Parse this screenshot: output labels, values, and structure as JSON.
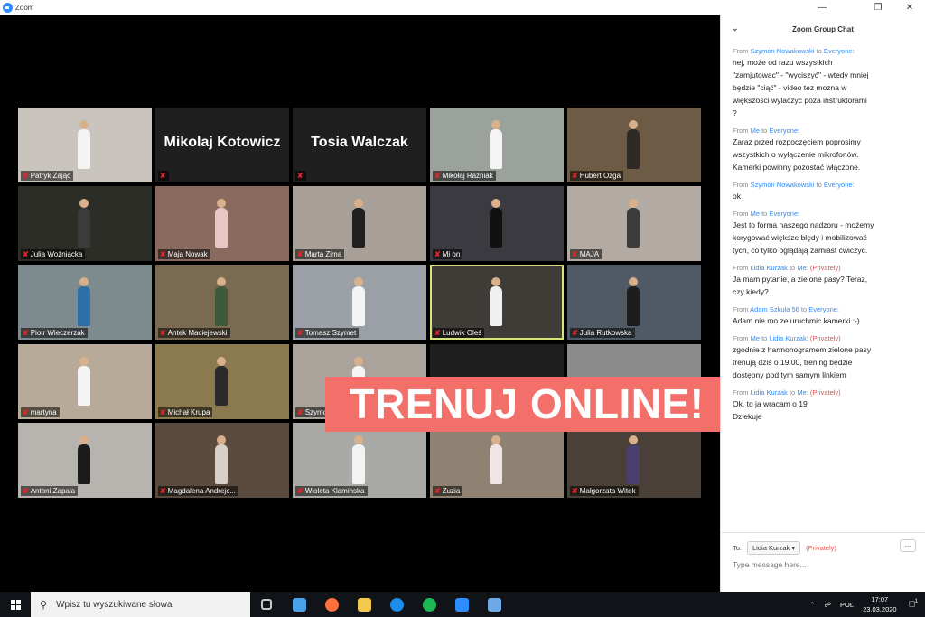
{
  "window": {
    "title": "Zoom"
  },
  "banner": {
    "text": "TRENUJ ONLINE!"
  },
  "tiles": [
    {
      "name": "Patryk Zając",
      "bg": "#c9c4bd",
      "fig": "#f3f3f3"
    },
    {
      "name": "Mikolaj Kotowicz",
      "bg": "#1f1f1f",
      "avatar": true
    },
    {
      "name": "Tosia Walczak",
      "bg": "#1f1f1f",
      "avatar": true
    },
    {
      "name": "Mikołaj Raźniak",
      "bg": "#9aa29b",
      "fig": "#f5f5f5"
    },
    {
      "name": "Hubert Ozga",
      "bg": "#6e5b46",
      "fig": "#2f2a25"
    },
    {
      "name": "Julia Woźniacka",
      "bg": "#2b2d26",
      "fig": "#3b3b3b"
    },
    {
      "name": "Maja Nowak",
      "bg": "#8a6a5e",
      "fig": "#e8c6c6"
    },
    {
      "name": "Marta Zima",
      "bg": "#a79f98",
      "fig": "#202020"
    },
    {
      "name": "Mi on",
      "bg": "#3a3a40",
      "fig": "#111111"
    },
    {
      "name": "MAJA",
      "bg": "#b3aba3",
      "fig": "#3c3c3c"
    },
    {
      "name": "Piotr Wieczerzak",
      "bg": "#7d8a8e",
      "fig": "#2f6fa8"
    },
    {
      "name": "Antek Maciejewski",
      "bg": "#7b6a52",
      "fig": "#3d5a3a"
    },
    {
      "name": "Tomasz Szymet",
      "bg": "#9aa0a6",
      "fig": "#f4f4f4"
    },
    {
      "name": "Ludwik Oleś",
      "bg": "#3f3b36",
      "fig": "#f0f0f0",
      "active": true
    },
    {
      "name": "Julia Rutkowska",
      "bg": "#4f5a64",
      "fig": "#1d1d1d"
    },
    {
      "name": "martyna",
      "bg": "#b8aa98",
      "fig": "#f4f4f4"
    },
    {
      "name": "Michał Krupa",
      "bg": "#8a7a4e",
      "fig": "#2a2a2a"
    },
    {
      "name": "Szymon",
      "bg": "#a9a39c",
      "fig": "#f5f5f5"
    },
    {
      "name": "",
      "bg": "#1f1f1f"
    },
    {
      "name": "",
      "bg": "#8b8b8b"
    },
    {
      "name": "Antoni Zapała",
      "bg": "#b7b4b0",
      "fig": "#1b1b1b"
    },
    {
      "name": "Magdalena Andrejc...",
      "bg": "#5b4b3e",
      "fig": "#d8d0c8"
    },
    {
      "name": "Wioleta Klaminska",
      "bg": "#a9a9a6",
      "fig": "#f3f3f3"
    },
    {
      "name": "Zuzia",
      "bg": "#8f8272",
      "fig": "#f0e4e4"
    },
    {
      "name": "Małgorzata Witek",
      "bg": "#4a4038",
      "fig": "#4a3f6e"
    }
  ],
  "chat": {
    "title": "Zoom Group Chat",
    "messages": [
      {
        "from_label": "From ",
        "sender": "Szymon Nowakowski",
        "to_label": " to ",
        "recipient": "Everyone",
        "suffix": ":",
        "private": "",
        "text": "hej, może od razu wszystkich\n\"zamjutowac\"  - \"wyciszyć\" - wtedy mniej\nbędzie \"ciąć\"  - video tez mozna w\nwiększości wylaczyc poza instruktorami\n?"
      },
      {
        "from_label": "From ",
        "sender": "Me",
        "to_label": " to ",
        "recipient": "Everyone",
        "suffix": ":",
        "private": "",
        "text": "Zaraz przed rozpoczęciem poprosimy\nwszystkich o wyłączenie mikrofonów.\nKamerki powinny pozostać włączone."
      },
      {
        "from_label": "From ",
        "sender": "Szymon Nowakowski",
        "to_label": " to ",
        "recipient": "Everyone",
        "suffix": ":",
        "private": "",
        "text": "ok"
      },
      {
        "from_label": "From ",
        "sender": "Me",
        "to_label": " to ",
        "recipient": "Everyone",
        "suffix": ":",
        "private": "",
        "text": "Jest to forma naszego nadzoru - możemy\nkorygować większe błędy i mobilizować\ntych, co tylko oglądają zamiast ćwiczyć."
      },
      {
        "from_label": "From ",
        "sender": "Lidia Kurzak",
        "to_label": " to ",
        "recipient": "Me",
        "suffix": ":",
        "private": "(Privately)",
        "text": "Ja mam pytanie, a zielone pasy? Teraz,\nczy kiedy?"
      },
      {
        "from_label": "From ",
        "sender": "Adam Szkuła 56",
        "to_label": " to ",
        "recipient": "Everyone",
        "suffix": ":",
        "private": "",
        "text": "Adam nie mo ze uruchmic  kamerki :-)"
      },
      {
        "from_label": "From ",
        "sender": "Me",
        "to_label": " to ",
        "recipient": "Lidia Kurzak",
        "suffix": ":",
        "private": "(Privately)",
        "text": "zgodnie z harmonogramem zielone pasy\ntrenują dziś o 19:00, trening będzie\ndostępny pod tym samym linkiem"
      },
      {
        "from_label": "From ",
        "sender": "Lidia Kurzak",
        "to_label": " to ",
        "recipient": "Me",
        "suffix": ":",
        "private": "(Privately)",
        "text": "Ok, to ja wracam o 19\nDziekuje"
      }
    ],
    "to_label": "To:",
    "to_value": "Lidia Kurzak",
    "to_private": "(Privately)",
    "more_label": "...",
    "input_placeholder": "Type message here..."
  },
  "taskbar": {
    "search_placeholder": "Wpisz tu wyszukiwane słowa",
    "apps": [
      {
        "icon": "task-view-icon",
        "color": "#c8c8c8"
      },
      {
        "icon": "edge-legacy-icon",
        "color": "#4aa3e8"
      },
      {
        "icon": "firefox-icon",
        "color": "#ff7139"
      },
      {
        "icon": "file-explorer-icon",
        "color": "#f2c94c"
      },
      {
        "icon": "edge-icon",
        "color": "#1c8ce8"
      },
      {
        "icon": "spotify-icon",
        "color": "#1db954"
      },
      {
        "icon": "zoom-icon",
        "color": "#2d8cff"
      },
      {
        "icon": "document-icon",
        "color": "#6ea8e8"
      }
    ],
    "lang": "POL",
    "time": "17:07",
    "date": "23.03.2020",
    "notification_count": "1"
  }
}
